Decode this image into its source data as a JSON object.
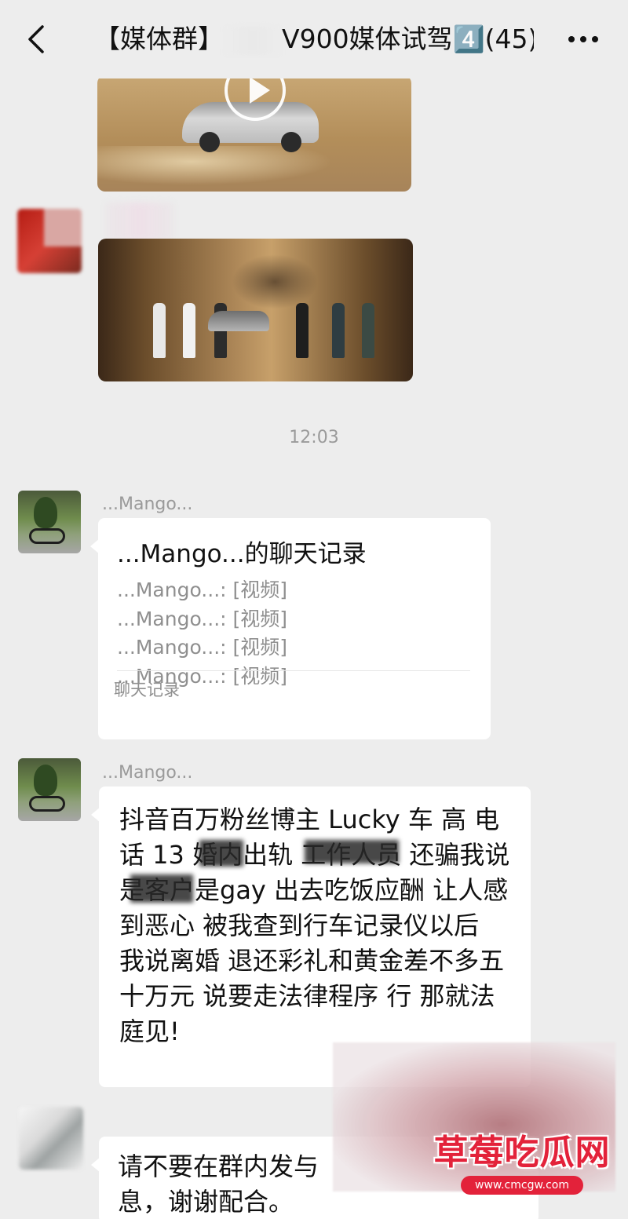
{
  "header": {
    "title_prefix": "【媒体群】",
    "title_suffix": "V900媒体试驾4️⃣(45)"
  },
  "timestamp": "12:03",
  "messages": [
    {
      "sender": "...Mango...",
      "type": "chat_record",
      "record": {
        "title": "...Mango...的聊天记录",
        "lines": [
          "...Mango...: [视频]",
          "...Mango...: [视频]",
          "...Mango...: [视频]",
          "...Mango...: [视频]"
        ],
        "footer": "聊天记录"
      }
    },
    {
      "sender": "...Mango...",
      "type": "text",
      "text": "抖音百万粉丝博主 Lucky 车 高 电话 13 婚内出轨 工作人员 还骗我说是客户是gay 出去吃饭应酬 让人感到恶心 被我查到行车记录仪以后 我说离婚 退还彩礼和黄金差不多五十万元 说要走法律程序 行 那就法庭见!"
    },
    {
      "type": "text",
      "text_line1": "请不要在群内发与",
      "text_line2": "息，谢谢配合。"
    }
  ],
  "watermark": {
    "title": "草莓吃瓜网",
    "url": "www.cmcgw.com"
  },
  "icons": [
    "back-icon",
    "more-icon",
    "play-icon"
  ]
}
